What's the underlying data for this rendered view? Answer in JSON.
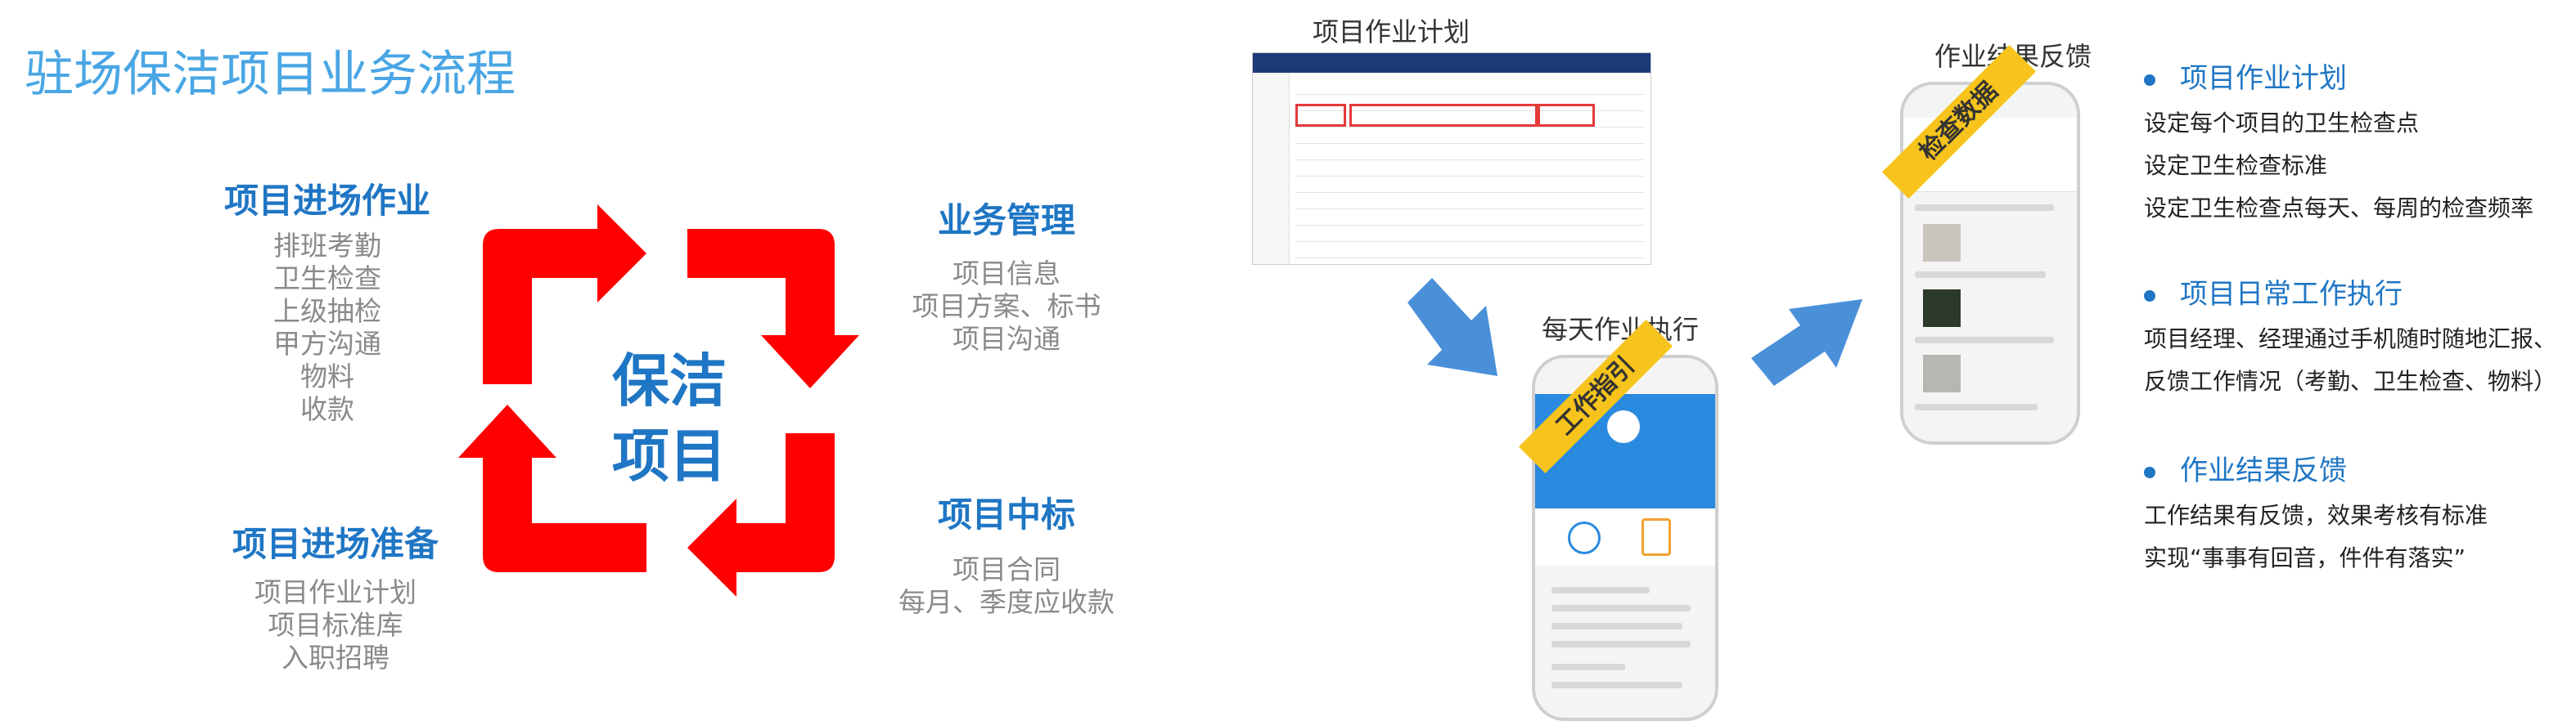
{
  "page_title": "驻场保洁项目业务流程",
  "cycle": {
    "center_line1": "保洁",
    "center_line2": "项目",
    "quadrants": {
      "top_left": {
        "title": "项目进场作业",
        "items": [
          "排班考勤",
          "卫生检查",
          "上级抽检",
          "甲方沟通",
          "物料",
          "收款"
        ]
      },
      "top_right": {
        "title": "业务管理",
        "items": [
          "项目信息",
          "项目方案、标书",
          "项目沟通"
        ]
      },
      "bottom_right": {
        "title": "项目中标",
        "items": [
          "项目合同",
          "每月、季度应收款"
        ]
      },
      "bottom_left": {
        "title": "项目进场准备",
        "items": [
          "项目作业计划",
          "项目标准库",
          "入职招聘"
        ]
      }
    },
    "arrow_color": "#ff0000"
  },
  "flow": {
    "plan_label": "项目作业计划",
    "daily_label": "每天作业执行",
    "feedback_label": "作业结果反馈",
    "daily_badge": "工作指引",
    "feedback_badge": "检查数据",
    "arrow_color": "#4a90d9"
  },
  "bullets": [
    {
      "title": "项目作业计划",
      "lines": [
        "设定每个项目的卫生检查点",
        "设定卫生检查标准",
        "设定卫生检查点每天、每周的检查频率"
      ]
    },
    {
      "title": "项目日常工作执行",
      "lines": [
        "项目经理、经理通过手机随时随地汇报、",
        "反馈工作情况（考勤、卫生检查、物料）"
      ]
    },
    {
      "title": "作业结果反馈",
      "lines": [
        "工作结果有反馈，效果考核有标准",
        "实现“事事有回音，件件有落实”"
      ]
    }
  ]
}
